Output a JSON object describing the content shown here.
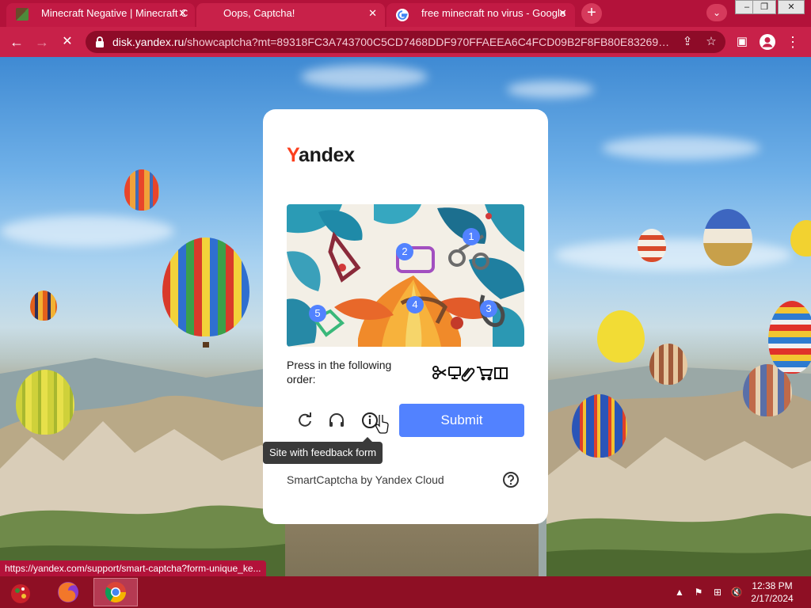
{
  "browser": {
    "tabs": [
      {
        "title": "Minecraft Negative | Minecraft C",
        "active": false
      },
      {
        "title": "Oops, Captcha!",
        "active": true
      },
      {
        "title": "free minecraft no virus - Google",
        "active": false
      }
    ],
    "new_tab_icon": "plus-icon",
    "address": {
      "host": "disk.yandex.ru",
      "path": "/showcaptcha?mt=89318FC3A743700C5CD7468DDF970FFAEEA6C4FCD09B2F8FB80E83269424ED..."
    }
  },
  "captcha": {
    "brand_y": "Y",
    "brand_rest": "andex",
    "instruction": "Press in the following order:",
    "markers": [
      "1",
      "2",
      "3",
      "4",
      "5"
    ],
    "submit_label": "Submit",
    "tooltip": "Site with feedback form",
    "footer": "SmartCaptcha by Yandex Cloud",
    "accent_color": "#5282ff",
    "brand_color": "#fc3f1d"
  },
  "status_url": "https://yandex.com/support/smart-captcha?form-unique_ke...",
  "taskbar": {
    "time": "12:38 PM",
    "date": "2/17/2024"
  },
  "colors": {
    "titlebar": "#b3123a",
    "toolbar": "#c82149",
    "taskbar": "#8e0f24"
  }
}
